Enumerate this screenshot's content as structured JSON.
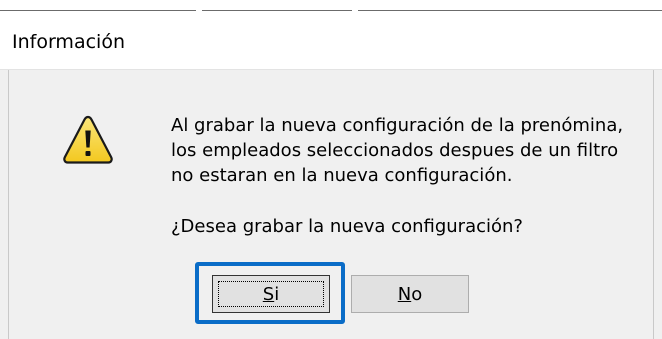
{
  "window": {
    "title": "Información"
  },
  "message": {
    "lines": [
      "Al grabar la nueva configuración de la prenómina,",
      "los empleados seleccionados despues de un filtro",
      "no estaran en la nueva configuración."
    ],
    "question": "¿Desea grabar la nueva configuración?"
  },
  "icon": {
    "type": "warning-icon",
    "fill_color": "#f8d94a",
    "outline_color": "#1a1a1a"
  },
  "buttons": {
    "yes": {
      "mnemonic": "S",
      "rest": "i",
      "focused": true
    },
    "no": {
      "mnemonic": "N",
      "rest": "o",
      "focused": false
    }
  },
  "colors": {
    "focus_ring": "#0a6cc7",
    "dialog_bg": "#f0f0f0",
    "button_bg": "#e1e1e1"
  }
}
